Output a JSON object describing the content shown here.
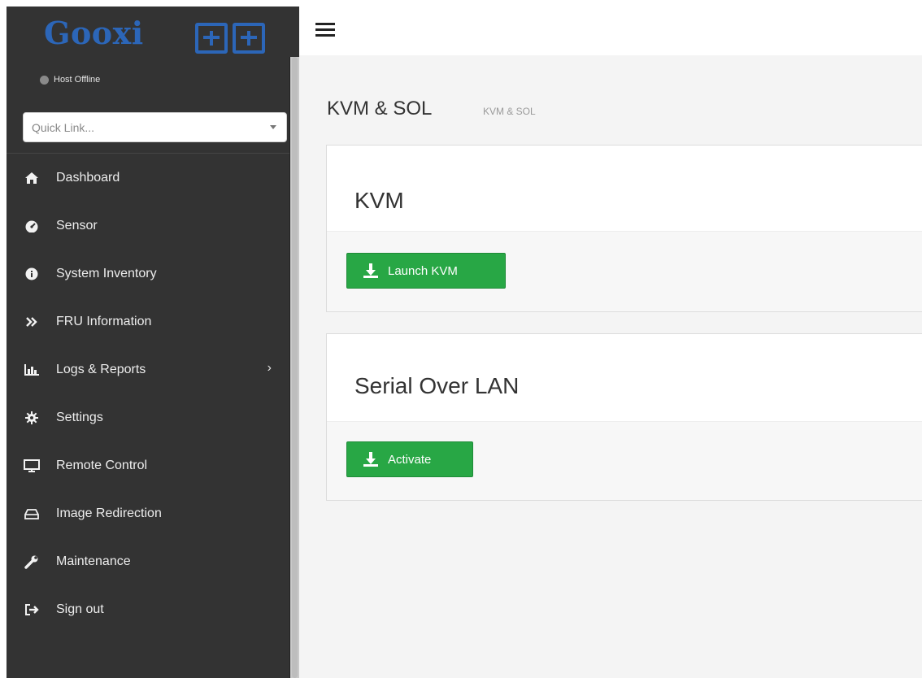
{
  "brand": {
    "logo_text": "Gooxi",
    "logo_cn": "国鑫"
  },
  "host": {
    "status": "Host Offline"
  },
  "quick_link": {
    "placeholder": "Quick Link..."
  },
  "sidebar": {
    "items": [
      {
        "label": "Dashboard",
        "icon": "home-icon"
      },
      {
        "label": "Sensor",
        "icon": "gauge-icon"
      },
      {
        "label": "System Inventory",
        "icon": "info-icon"
      },
      {
        "label": "FRU Information",
        "icon": "double-chevron-right-icon"
      },
      {
        "label": "Logs & Reports",
        "icon": "bar-chart-icon",
        "has_submenu": true
      },
      {
        "label": "Settings",
        "icon": "gear-icon"
      },
      {
        "label": "Remote Control",
        "icon": "monitor-icon"
      },
      {
        "label": "Image Redirection",
        "icon": "hdd-icon"
      },
      {
        "label": "Maintenance",
        "icon": "wrench-icon"
      },
      {
        "label": "Sign out",
        "icon": "sign-out-icon"
      }
    ]
  },
  "page": {
    "title": "KVM & SOL",
    "breadcrumb": "KVM & SOL"
  },
  "panels": {
    "kvm": {
      "title": "KVM",
      "button_label": "Launch KVM"
    },
    "sol": {
      "title": "Serial Over LAN",
      "button_label": "Activate"
    }
  },
  "colors": {
    "sidebar_bg": "#333333",
    "brand_blue": "#2c66b8",
    "button_green": "#28a745"
  }
}
